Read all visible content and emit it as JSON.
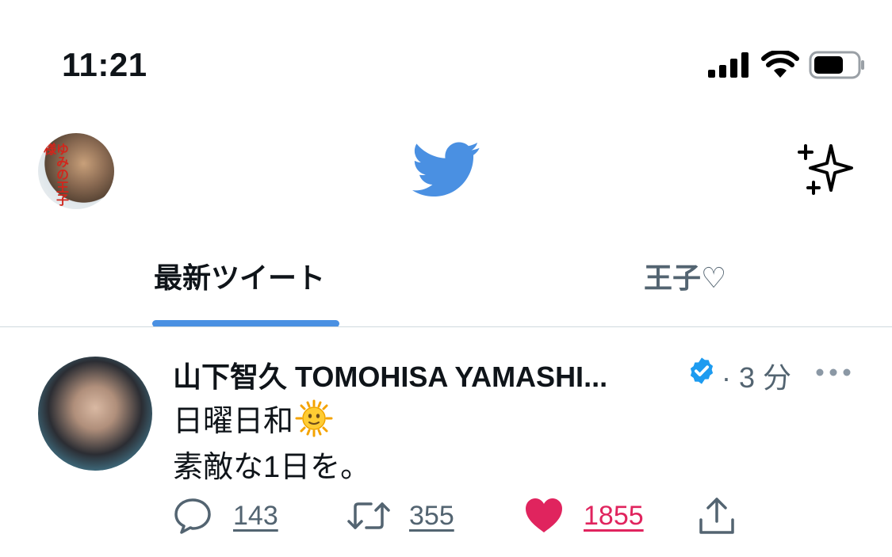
{
  "status_bar": {
    "time": "11:21"
  },
  "header": {
    "avatar_text": "ゆみの王子様"
  },
  "tabs": [
    {
      "label": "最新ツイート",
      "active": true
    },
    {
      "label": "王子♡",
      "active": false
    }
  ],
  "tweet": {
    "author": "山下智久 TOMOHISA YAMASHI...",
    "meta": "· 3 分",
    "lines": [
      "日曜日和",
      "素敵な1日を。"
    ],
    "emoji": "sun-with-face",
    "counts": {
      "replies": "143",
      "retweets": "355",
      "likes": "1855"
    }
  },
  "colors": {
    "twitter_blue": "#4a90e2",
    "like_pink": "#e0245e",
    "muted": "#536471"
  },
  "icons": [
    "signal-icon",
    "wifi-icon",
    "battery-icon",
    "twitter-bird-icon",
    "sparkle-icon",
    "verified-badge-icon",
    "more-icon",
    "reply-icon",
    "retweet-icon",
    "like-icon",
    "share-icon"
  ]
}
